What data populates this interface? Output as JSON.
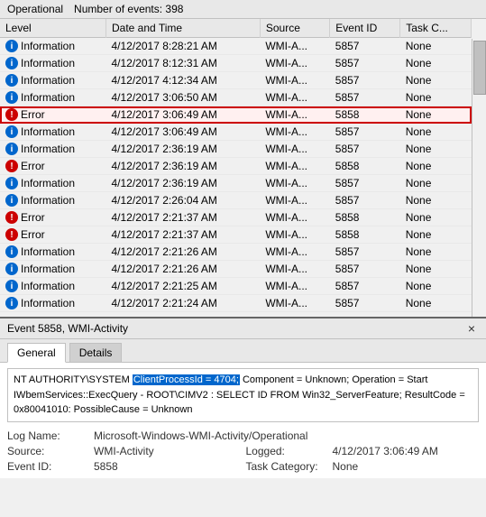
{
  "topbar": {
    "operational_label": "Operational",
    "events_count_label": "Number of events: 398"
  },
  "table": {
    "headers": [
      "Level",
      "Date and Time",
      "Source",
      "Event ID",
      "Task C..."
    ],
    "rows": [
      {
        "level": "Information",
        "level_type": "info",
        "datetime": "4/12/2017 8:28:21 AM",
        "source": "WMI-A...",
        "event_id": "5857",
        "task": "None"
      },
      {
        "level": "Information",
        "level_type": "info",
        "datetime": "4/12/2017 8:12:31 AM",
        "source": "WMI-A...",
        "event_id": "5857",
        "task": "None"
      },
      {
        "level": "Information",
        "level_type": "info",
        "datetime": "4/12/2017 4:12:34 AM",
        "source": "WMI-A...",
        "event_id": "5857",
        "task": "None"
      },
      {
        "level": "Information",
        "level_type": "info",
        "datetime": "4/12/2017 3:06:50 AM",
        "source": "WMI-A...",
        "event_id": "5857",
        "task": "None"
      },
      {
        "level": "Error",
        "level_type": "error",
        "datetime": "4/12/2017 3:06:49 AM",
        "source": "WMI-A...",
        "event_id": "5858",
        "task": "None",
        "selected": true
      },
      {
        "level": "Information",
        "level_type": "info",
        "datetime": "4/12/2017 3:06:49 AM",
        "source": "WMI-A...",
        "event_id": "5857",
        "task": "None"
      },
      {
        "level": "Information",
        "level_type": "info",
        "datetime": "4/12/2017 2:36:19 AM",
        "source": "WMI-A...",
        "event_id": "5857",
        "task": "None"
      },
      {
        "level": "Error",
        "level_type": "error",
        "datetime": "4/12/2017 2:36:19 AM",
        "source": "WMI-A...",
        "event_id": "5858",
        "task": "None"
      },
      {
        "level": "Information",
        "level_type": "info",
        "datetime": "4/12/2017 2:36:19 AM",
        "source": "WMI-A...",
        "event_id": "5857",
        "task": "None"
      },
      {
        "level": "Information",
        "level_type": "info",
        "datetime": "4/12/2017 2:26:04 AM",
        "source": "WMI-A...",
        "event_id": "5857",
        "task": "None"
      },
      {
        "level": "Error",
        "level_type": "error",
        "datetime": "4/12/2017 2:21:37 AM",
        "source": "WMI-A...",
        "event_id": "5858",
        "task": "None"
      },
      {
        "level": "Error",
        "level_type": "error",
        "datetime": "4/12/2017 2:21:37 AM",
        "source": "WMI-A...",
        "event_id": "5858",
        "task": "None"
      },
      {
        "level": "Information",
        "level_type": "info",
        "datetime": "4/12/2017 2:21:26 AM",
        "source": "WMI-A...",
        "event_id": "5857",
        "task": "None"
      },
      {
        "level": "Information",
        "level_type": "info",
        "datetime": "4/12/2017 2:21:26 AM",
        "source": "WMI-A...",
        "event_id": "5857",
        "task": "None"
      },
      {
        "level": "Information",
        "level_type": "info",
        "datetime": "4/12/2017 2:21:25 AM",
        "source": "WMI-A...",
        "event_id": "5857",
        "task": "None"
      },
      {
        "level": "Information",
        "level_type": "info",
        "datetime": "4/12/2017 2:21:24 AM",
        "source": "WMI-A...",
        "event_id": "5857",
        "task": "None"
      }
    ]
  },
  "detail": {
    "title": "Event 5858, WMI-Activity",
    "close_label": "×",
    "tabs": [
      "General",
      "Details"
    ],
    "active_tab": "General",
    "description_prefix": "NT AUTHORITY\\SYSTEM ",
    "description_highlight": "ClientProcessId = 4704;",
    "description_suffix": " Component = Unknown; Operation = Start IWbemServices::ExecQuery - ROOT\\CIMV2 : SELECT ID FROM Win32_ServerFeature; ResultCode = 0x80041010: PossibleCause = Unknown",
    "fields": {
      "log_name_label": "Log Name:",
      "log_name_value": "Microsoft-Windows-WMI-Activity/Operational",
      "source_label": "Source:",
      "source_value": "WMI-Activity",
      "logged_label": "Logged:",
      "logged_value": "4/12/2017 3:06:49 AM",
      "event_id_label": "Event ID:",
      "event_id_value": "5858",
      "task_category_label": "Task Category:",
      "task_category_value": "None"
    }
  }
}
